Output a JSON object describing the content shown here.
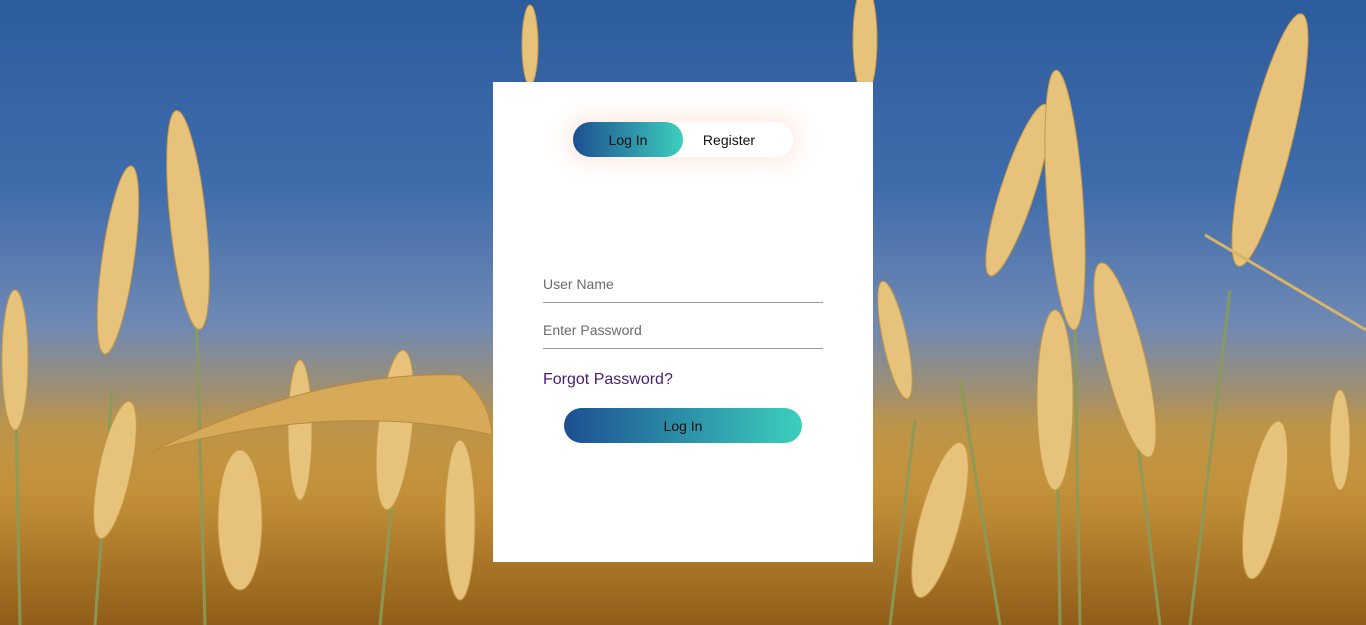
{
  "background": {
    "description_icon": "wheat-field-image",
    "sky_color": "#2d5c9e",
    "wheat_color": "#c58f36"
  },
  "toggle": {
    "login_label": "Log In",
    "register_label": "Register",
    "active": "login"
  },
  "form": {
    "username_placeholder": "User Name",
    "username_value": "",
    "password_placeholder": "Enter Password",
    "password_value": "",
    "forgot_label": "Forgot Password?",
    "submit_label": "Log In"
  },
  "colors": {
    "gradient_start": "#1d4f92",
    "gradient_end": "#3ccfbd",
    "link": "#4a1d6e"
  }
}
